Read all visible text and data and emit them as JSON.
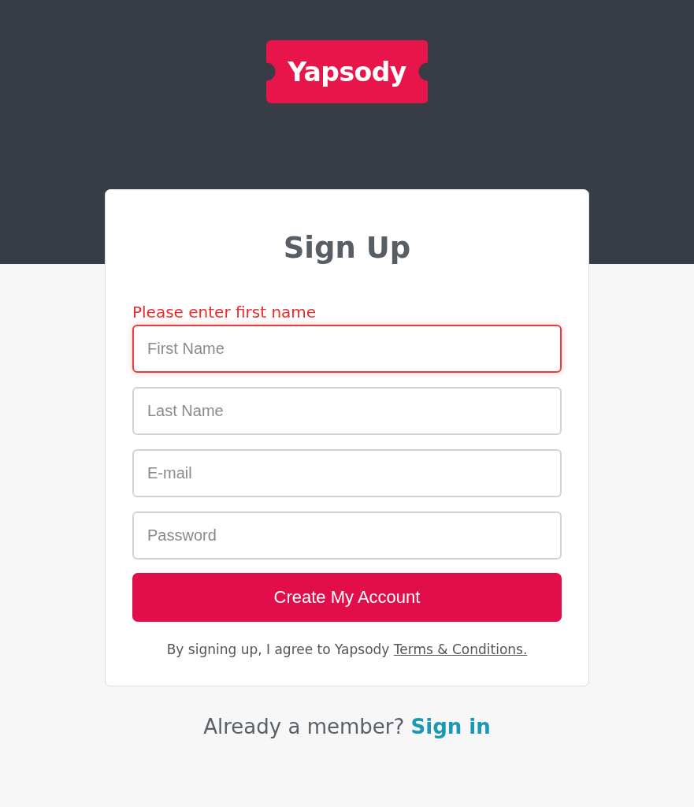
{
  "logo": {
    "text": "Yapsody"
  },
  "form": {
    "title": "Sign Up",
    "error": "Please enter first name",
    "fields": [
      {
        "placeholder": "First Name",
        "invalid": true
      },
      {
        "placeholder": "Last Name",
        "invalid": false
      },
      {
        "placeholder": "E-mail",
        "invalid": false
      },
      {
        "placeholder": "Password",
        "invalid": false
      }
    ],
    "button": "Create My Account",
    "terms": {
      "text": "By signing up, I agree to Yapsody",
      "link": "Terms & Conditions."
    }
  },
  "footer": {
    "text": "Already a member?",
    "link": "Sign in"
  }
}
